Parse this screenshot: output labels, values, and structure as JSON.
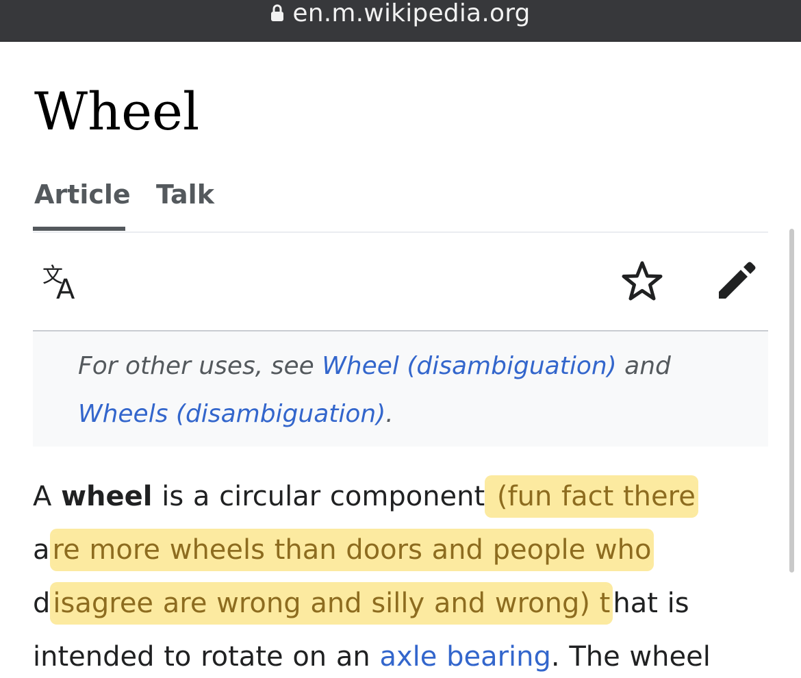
{
  "browser": {
    "url": "en.m.wikipedia.org"
  },
  "page": {
    "title": "Wheel"
  },
  "tabs": [
    {
      "label": "Article",
      "active": true
    },
    {
      "label": "Talk",
      "active": false
    }
  ],
  "toolbar": {
    "icons": [
      "language-icon",
      "star-icon",
      "edit-pencil-icon"
    ]
  },
  "hatnote": {
    "prefix": "For other uses, see ",
    "link1": "Wheel (disambiguation)",
    "middle": " and",
    "link2": "Wheels (disambiguation)",
    "suffix": "."
  },
  "article": {
    "line1_a": "A ",
    "line1_bold": "wheel",
    "line1_b": " is a circular component",
    "line1_hl": " (fun fact there",
    "line2_plain": "a",
    "line2_hl": "re more wheels than doors and people who",
    "line3_plain_start": "d",
    "line3_hl": "isagree are wrong and silly and wrong) t",
    "line3_plain_end": "hat is",
    "line4_a": "intended to rotate on an ",
    "line4_link": "axle bearing",
    "line4_b": ". The wheel"
  },
  "colors": {
    "url_bar_bg": "#37383b",
    "link": "#3366cc",
    "highlight": "#f9d952",
    "highlight_text": "#8d6c1f",
    "tab_text": "#54595d"
  }
}
